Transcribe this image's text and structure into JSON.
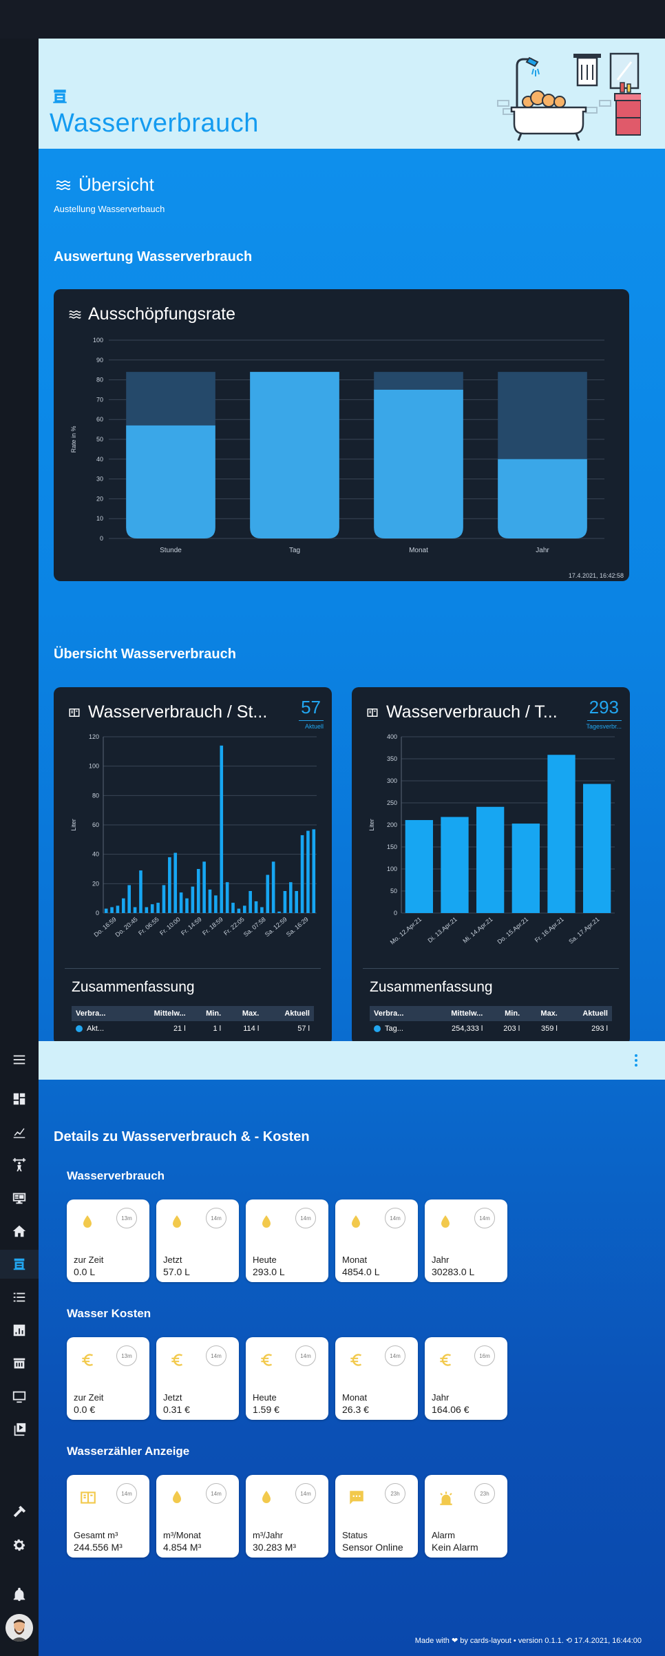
{
  "header": {
    "title": "Wasserverbrauch"
  },
  "overview": {
    "title": "Übersicht",
    "subtitle": "Austellung Wasserverbauch"
  },
  "auswertung": {
    "section_title": "Auswertung Wasserverbrauch",
    "card_title": "Ausschöpfungsrate",
    "timestamp": "17.4.2021, 16:42:58"
  },
  "uebersicht_section": {
    "title": "Übersicht Wasserverbrauch"
  },
  "card_stunde": {
    "title": "Wasserverbrauch / St...",
    "value": "57",
    "value_label": "Aktuell",
    "summary_title": "Zusammenfassung",
    "table": {
      "headers": [
        "Verbra...",
        "Mittelw...",
        "Min.",
        "Max.",
        "Aktuell"
      ],
      "row": [
        "Akt...",
        "21 l",
        "1 l",
        "114 l",
        "57 l"
      ]
    }
  },
  "card_tag": {
    "title": "Wasserverbrauch / T...",
    "value": "293",
    "value_label": "Tagesverbr...",
    "summary_title": "Zusammenfassung",
    "table": {
      "headers": [
        "Verbra...",
        "Mittelw...",
        "Min.",
        "Max.",
        "Aktuell"
      ],
      "row": [
        "Tag...",
        "254,333 l",
        "203 l",
        "359 l",
        "293 l"
      ]
    }
  },
  "details": {
    "title": "Details zu Wasserverbrauch & - Kosten"
  },
  "groups": [
    {
      "title": "Wasserverbrauch",
      "tiles": [
        {
          "icon": "water-drop-icon",
          "badge": "13m",
          "label": "zur Zeit",
          "value": "0.0 L"
        },
        {
          "icon": "water-drop-icon",
          "badge": "14m",
          "label": "Jetzt",
          "value": "57.0 L"
        },
        {
          "icon": "water-drop-icon",
          "badge": "14m",
          "label": "Heute",
          "value": "293.0 L"
        },
        {
          "icon": "water-drop-icon",
          "badge": "14m",
          "label": "Monat",
          "value": "4854.0 L"
        },
        {
          "icon": "water-drop-icon",
          "badge": "14m",
          "label": "Jahr",
          "value": "30283.0 L"
        }
      ]
    },
    {
      "title": "Wasser Kosten",
      "tiles": [
        {
          "icon": "euro-icon",
          "badge": "13m",
          "label": "zur Zeit",
          "value": "0.0 €"
        },
        {
          "icon": "euro-icon",
          "badge": "14m",
          "label": "Jetzt",
          "value": "0.31 €"
        },
        {
          "icon": "euro-icon",
          "badge": "14m",
          "label": "Heute",
          "value": "1.59 €"
        },
        {
          "icon": "euro-icon",
          "badge": "14m",
          "label": "Monat",
          "value": "26.3 €"
        },
        {
          "icon": "euro-icon",
          "badge": "16m",
          "label": "Jahr",
          "value": "164.06 €"
        }
      ]
    },
    {
      "title": "Wasserzähler Anzeige",
      "tiles": [
        {
          "icon": "counter-icon",
          "badge": "14m",
          "label": "Gesamt m³",
          "value": "244.556 M³"
        },
        {
          "icon": "water-drop-icon",
          "badge": "14m",
          "label": "m³/Monat",
          "value": "4.854 M³"
        },
        {
          "icon": "water-drop-icon",
          "badge": "14m",
          "label": "m³/Jahr",
          "value": "30.283 M³"
        },
        {
          "icon": "message-icon",
          "badge": "23h",
          "label": "Status",
          "value": "Sensor Online"
        },
        {
          "icon": "alarm-light-icon",
          "badge": "23h",
          "label": "Alarm",
          "value": "Kein Alarm"
        }
      ]
    }
  ],
  "footer": {
    "text": "Made with ❤ by cards-layout • version 0.1.1. ⟲ 17.4.2021, 16:44:00"
  },
  "colors": {
    "accent": "#22a6f0",
    "bar": "#3aa7e8",
    "bar_bg": "#25496a",
    "tile_icon": "#f2c94c"
  },
  "chart_data": [
    {
      "type": "bar",
      "title": "Ausschöpfungsrate",
      "categories": [
        "Stunde",
        "Tag",
        "Monat",
        "Jahr"
      ],
      "values": [
        57,
        84,
        75,
        40
      ],
      "max_values": [
        84,
        84,
        84,
        84
      ],
      "ylabel": "Rate in %",
      "ylim": [
        0,
        100
      ],
      "yticks": [
        0,
        10,
        20,
        30,
        40,
        50,
        60,
        70,
        80,
        90,
        100
      ],
      "grid": true
    },
    {
      "type": "bar",
      "title": "Wasserverbrauch / St...",
      "ylabel": "Liter",
      "ylim": [
        0,
        120
      ],
      "yticks": [
        0,
        20,
        40,
        60,
        80,
        100,
        120
      ],
      "xtick_labels": [
        "Do. 16:59",
        "Do. 20:45",
        "Fr. 06:55",
        "Fr. 10:00",
        "Fr. 14:59",
        "Fr. 18:59",
        "Fr. 22:05",
        "Sa. 07:58",
        "Sa. 12:59",
        "Sa. 16:29"
      ],
      "values": [
        3,
        4,
        5,
        10,
        19,
        4,
        29,
        4,
        6,
        7,
        19,
        38,
        41,
        14,
        10,
        18,
        30,
        35,
        16,
        12,
        114,
        21,
        7,
        3,
        5,
        15,
        8,
        4,
        26,
        35,
        1,
        15,
        21,
        15,
        53,
        56,
        57
      ],
      "grid": true
    },
    {
      "type": "bar",
      "title": "Wasserverbrauch / T...",
      "ylabel": "Liter",
      "ylim": [
        0,
        400
      ],
      "yticks": [
        0,
        50,
        100,
        150,
        200,
        250,
        300,
        350,
        400
      ],
      "categories": [
        "Mo. 12.Apr.21",
        "Di. 13.Apr.21",
        "Mi. 14.Apr.21",
        "Do. 15.Apr.21",
        "Fr. 16.Apr.21",
        "Sa. 17.Apr.21"
      ],
      "values": [
        211,
        218,
        241,
        203,
        359,
        293
      ],
      "grid": true
    }
  ]
}
